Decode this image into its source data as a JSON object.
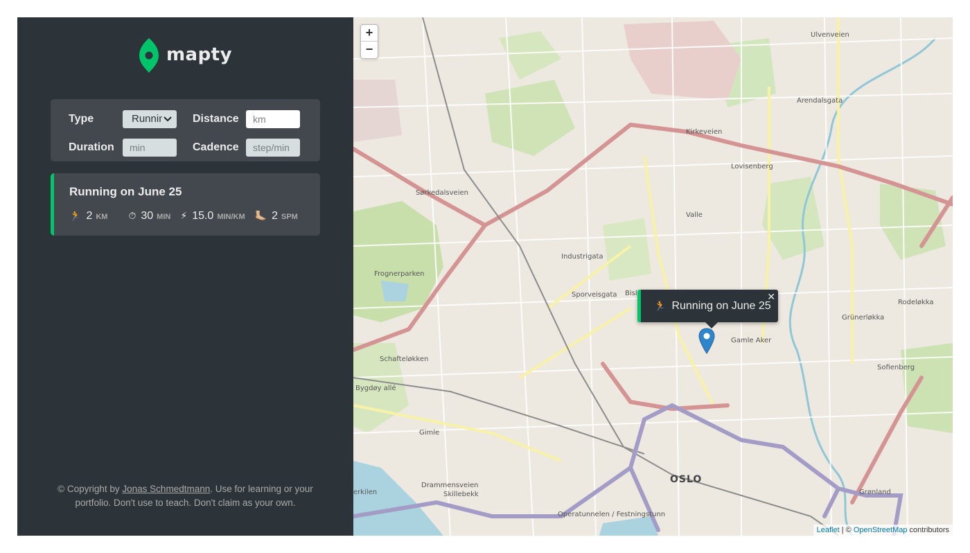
{
  "app": {
    "logo_text": "mapty",
    "brand_color": "#00c46a",
    "sidebar_bg": "#2d3439",
    "panel_bg": "#42484d"
  },
  "form": {
    "type_label": "Type",
    "type_value": "Running",
    "distance_label": "Distance",
    "distance_placeholder": "km",
    "duration_label": "Duration",
    "duration_placeholder": "min",
    "cadence_label": "Cadence",
    "cadence_placeholder": "step/min"
  },
  "workouts": [
    {
      "title": "Running on June 25",
      "distance": {
        "icon": "🏃",
        "value": "2",
        "unit": "km"
      },
      "duration": {
        "icon": "⏱",
        "value": "30",
        "unit": "min"
      },
      "pace": {
        "icon": "⚡",
        "value": "15.0",
        "unit": "min/km"
      },
      "cadence": {
        "icon": "🦶🏼",
        "value": "2",
        "unit": "spm"
      }
    }
  ],
  "copyright": {
    "prefix": "© Copyright by ",
    "author": "Jonas Schmedtmann",
    "suffix": ". Use for learning or your portfolio. Don't use to teach. Don't claim as your own."
  },
  "map": {
    "zoom_in": "+",
    "zoom_out": "−",
    "popup": {
      "icon": "🏃",
      "text": "Running on June 25",
      "close": "✕"
    },
    "attribution": {
      "leaflet": "Leaflet",
      "sep": " | © ",
      "osm": "OpenStreetMap",
      "suffix": " contributors"
    },
    "labels": {
      "oslo": "OSLO",
      "kirkeveien": "Kirkeveien",
      "frognerparken": "Frognerparken",
      "valle": "Valle",
      "lovisenberg": "Lovisenberg",
      "schafteloekken": "Schafteløkken",
      "bygdoy": "Bygdøy allé",
      "gimle": "Gimle",
      "skillebekk": "Skillebekk",
      "gamle_aker": "Gamle Aker",
      "grunerlokka": "Grünerløkka",
      "sofienberg": "Sofienberg",
      "rodelokka": "Rodeløkka",
      "gronland": "Grønland",
      "sorkedalsveien": "Sørkedalsveien",
      "industrigata": "Industrigata",
      "sporveisgata": "Sporveisgata",
      "arendalsgata": "Arendalsgata",
      "ulvenveien": "Ulvenveien",
      "bislett": "Bislett",
      "drammensveien": "Drammensveien",
      "operatunnelen": "Operatunnelen / Festningstunn",
      "kerkilen": "erkilen"
    }
  }
}
